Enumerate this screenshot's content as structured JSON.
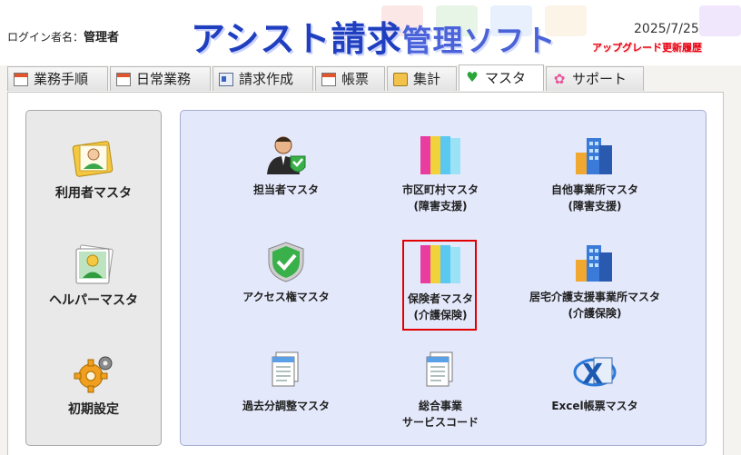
{
  "header": {
    "login_label": "ログイン者名：",
    "login_user": "管理者",
    "title_main": "アシスト請求",
    "title_sub": "管理ソフト",
    "date": "2025/7/25",
    "upgrade_link": "アップグレード更新履歴"
  },
  "tabs": [
    {
      "label": "業務手順",
      "icon": "document-icon"
    },
    {
      "label": "日常業務",
      "icon": "document-icon"
    },
    {
      "label": "請求作成",
      "icon": "card-icon"
    },
    {
      "label": "帳票",
      "icon": "document-icon"
    },
    {
      "label": "集計",
      "icon": "calculator-icon"
    },
    {
      "label": "マスタ",
      "icon": "heart-icon",
      "active": true
    },
    {
      "label": "サポート",
      "icon": "flower-icon"
    }
  ],
  "left_items": [
    {
      "label": "利用者マスタ",
      "icon": "user-folder-icon"
    },
    {
      "label": "ヘルパーマスタ",
      "icon": "user-photo-icon"
    },
    {
      "label": "初期設定",
      "icon": "gear-icon"
    }
  ],
  "main_items": [
    {
      "line1": "担当者マスタ",
      "line2": "",
      "icon": "staff-person-icon"
    },
    {
      "line1": "市区町村マスタ",
      "line2": "(障害支援)",
      "icon": "binders-icon"
    },
    {
      "line1": "自他事業所マスタ",
      "line2": "(障害支援)",
      "icon": "building-icon"
    },
    {
      "line1": "アクセス権マスタ",
      "line2": "",
      "icon": "shield-check-icon"
    },
    {
      "line1": "保険者マスタ",
      "line2": "(介護保険)",
      "icon": "binders-icon"
    },
    {
      "line1": "居宅介護支援事業所マスタ",
      "line2": "(介護保険)",
      "icon": "building-icon"
    },
    {
      "line1": "過去分調整マスタ",
      "line2": "",
      "icon": "documents-icon"
    },
    {
      "line1": "総合事業",
      "line2": "サービスコード",
      "icon": "documents-icon"
    },
    {
      "line1": "Excel帳票マスタ",
      "line2": "",
      "icon": "excel-icon"
    }
  ],
  "colors": {
    "accent": "#1f3fbf",
    "panel": "#e4e8fb",
    "highlight": "#e00000",
    "upgrade": "#e60012"
  }
}
